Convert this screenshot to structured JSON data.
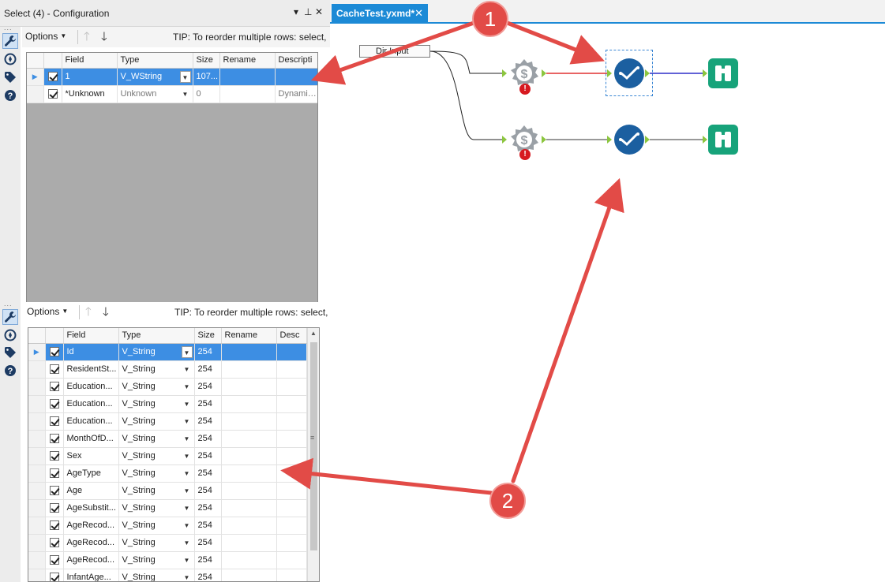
{
  "config_panel": {
    "title": "Select (4) - Configuration",
    "controls": {
      "dropdown": "▾",
      "pin": "⊥",
      "close": "✕"
    },
    "side_icons": [
      "wrench-icon",
      "compass-icon",
      "tag-icon",
      "help-icon"
    ]
  },
  "top_grid": {
    "toolbar": {
      "options_label": "Options",
      "tip": "TIP: To reorder multiple rows: select, ri"
    },
    "columns": [
      "Field",
      "Type",
      "Size",
      "Rename",
      "Descripti"
    ],
    "rows": [
      {
        "field": "1",
        "type": "V_WString",
        "size": "107...",
        "rename": "",
        "description": "",
        "checked": true,
        "selected": true
      },
      {
        "field": "*Unknown",
        "type": "Unknown",
        "size": "0",
        "rename": "",
        "description": "Dynamic o",
        "checked": true,
        "selected": false
      }
    ]
  },
  "bottom_grid": {
    "toolbar": {
      "options_label": "Options",
      "tip": "TIP: To reorder multiple rows: select, ri"
    },
    "columns": [
      "Field",
      "Type",
      "Size",
      "Rename",
      "Desc"
    ],
    "rows": [
      {
        "field": "Id",
        "type": "V_String",
        "size": "254",
        "selected": true
      },
      {
        "field": "ResidentSt...",
        "type": "V_String",
        "size": "254"
      },
      {
        "field": "Education...",
        "type": "V_String",
        "size": "254"
      },
      {
        "field": "Education...",
        "type": "V_String",
        "size": "254"
      },
      {
        "field": "Education...",
        "type": "V_String",
        "size": "254"
      },
      {
        "field": "MonthOfD...",
        "type": "V_String",
        "size": "254"
      },
      {
        "field": "Sex",
        "type": "V_String",
        "size": "254"
      },
      {
        "field": "AgeType",
        "type": "V_String",
        "size": "254"
      },
      {
        "field": "Age",
        "type": "V_String",
        "size": "254"
      },
      {
        "field": "AgeSubstit...",
        "type": "V_String",
        "size": "254"
      },
      {
        "field": "AgeRecod...",
        "type": "V_String",
        "size": "254"
      },
      {
        "field": "AgeRecod...",
        "type": "V_String",
        "size": "254"
      },
      {
        "field": "AgeRecod...",
        "type": "V_String",
        "size": "254"
      },
      {
        "field": "InfantAge...",
        "type": "V_String",
        "size": "254"
      }
    ]
  },
  "canvas": {
    "tab_label": "CacheTest.yxmd*",
    "tab_close": "✕",
    "input_label": "Dir Input",
    "error_mark": "!",
    "annotations": [
      "1",
      "2"
    ]
  },
  "colors": {
    "accent_blue": "#1c8ad6",
    "select_tool": "#1b5fa0",
    "browse_tool": "#17a37a",
    "annotation_red": "#e24b47"
  }
}
